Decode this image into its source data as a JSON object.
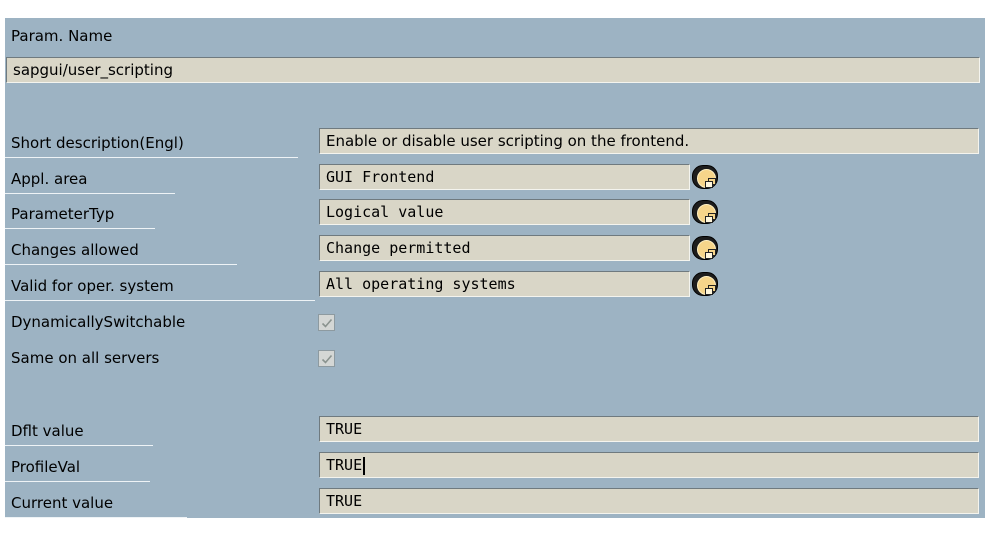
{
  "header": {
    "label": "Param. Name",
    "value": "sapgui/user_scripting"
  },
  "attributes": {
    "short_description": {
      "label": "Short description(Engl)",
      "value": "Enable or disable user scripting on the frontend."
    },
    "appl_area": {
      "label": "Appl. area",
      "value": "GUI Frontend"
    },
    "parameter_type": {
      "label": "ParameterTyp",
      "value": "Logical value"
    },
    "changes_allowed": {
      "label": "Changes allowed",
      "value": "Change permitted"
    },
    "valid_os": {
      "label": "Valid for oper. system",
      "value": "All operating systems"
    },
    "dynamically_switchable": {
      "label": "DynamicallySwitchable",
      "checked": true
    },
    "same_on_all_servers": {
      "label": "Same on all servers",
      "checked": true
    }
  },
  "values": {
    "default": {
      "label": "Dflt value",
      "value": "TRUE"
    },
    "profile": {
      "label": "ProfileVal",
      "value": "TRUE"
    },
    "current": {
      "label": "Current value",
      "value": "TRUE"
    }
  },
  "icons": {
    "value_help": "value-help-icon",
    "checkmark": "checkmark-icon"
  },
  "colors": {
    "panel_background": "#9db3c3",
    "field_background": "#d9d6c7",
    "button_fill": "#f6d58a"
  }
}
